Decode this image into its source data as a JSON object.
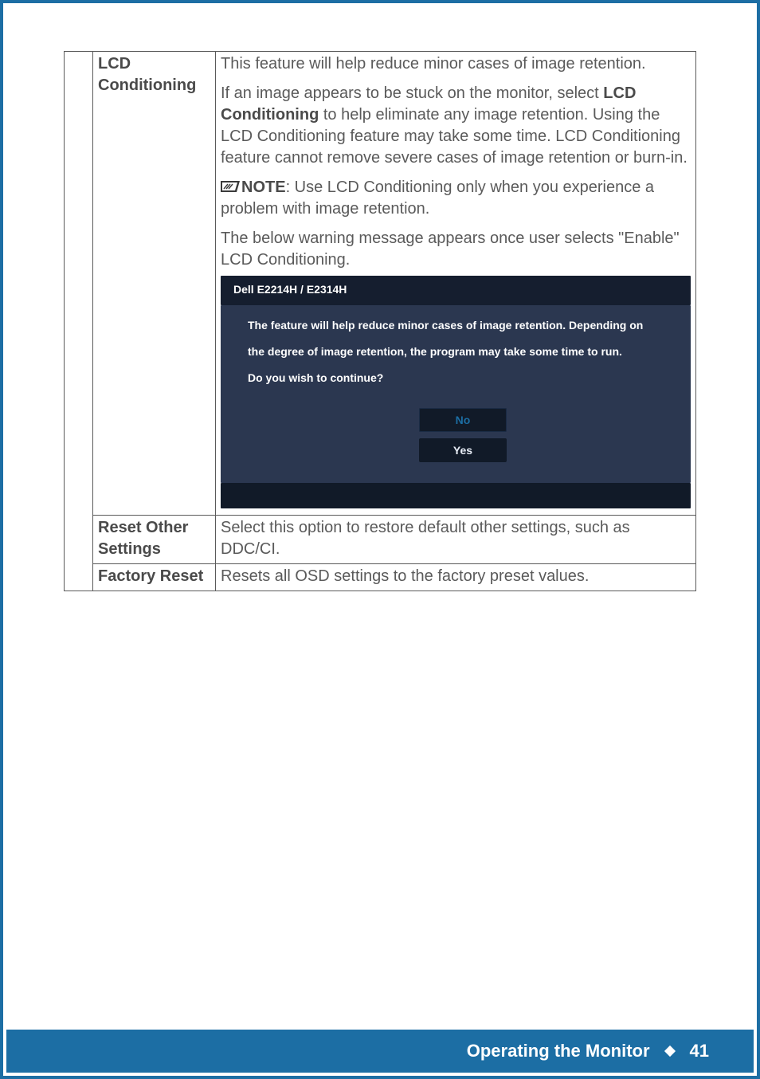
{
  "rows": {
    "lcd": {
      "label": "LCD Conditioning",
      "intro": "This feature will help reduce minor cases of image retention.",
      "para2_a": "If an image appears to be stuck on the monitor, select ",
      "para2_bold": "LCD Conditioning",
      "para2_b": " to help eliminate any image retention. Using the LCD Conditioning feature may take some time. LCD Conditioning feature cannot remove  severe cases of image retention or burn-in.",
      "note_label": "NOTE",
      "note_text": ": Use LCD Conditioning only when you experience a problem with image retention.",
      "para3": "The below warning message appears once user selects \"Enable\" LCD Conditioning."
    },
    "reset_other": {
      "label": "Reset Other Settings",
      "desc": "Select this option to restore default other settings, such as DDC/CI."
    },
    "factory_reset": {
      "label": "Factory Reset",
      "desc": "Resets all OSD settings to the factory preset values."
    }
  },
  "dialog": {
    "title": "Dell E2214H / E2314H",
    "line1": "The feature will help reduce minor cases of image retention. Depending on",
    "line2": "the degree of image retention, the program may take some time to run.",
    "line3": "Do you wish to continue?",
    "btn_no": "No",
    "btn_yes": "Yes"
  },
  "footer": {
    "section": "Operating the Monitor",
    "page": "41"
  }
}
